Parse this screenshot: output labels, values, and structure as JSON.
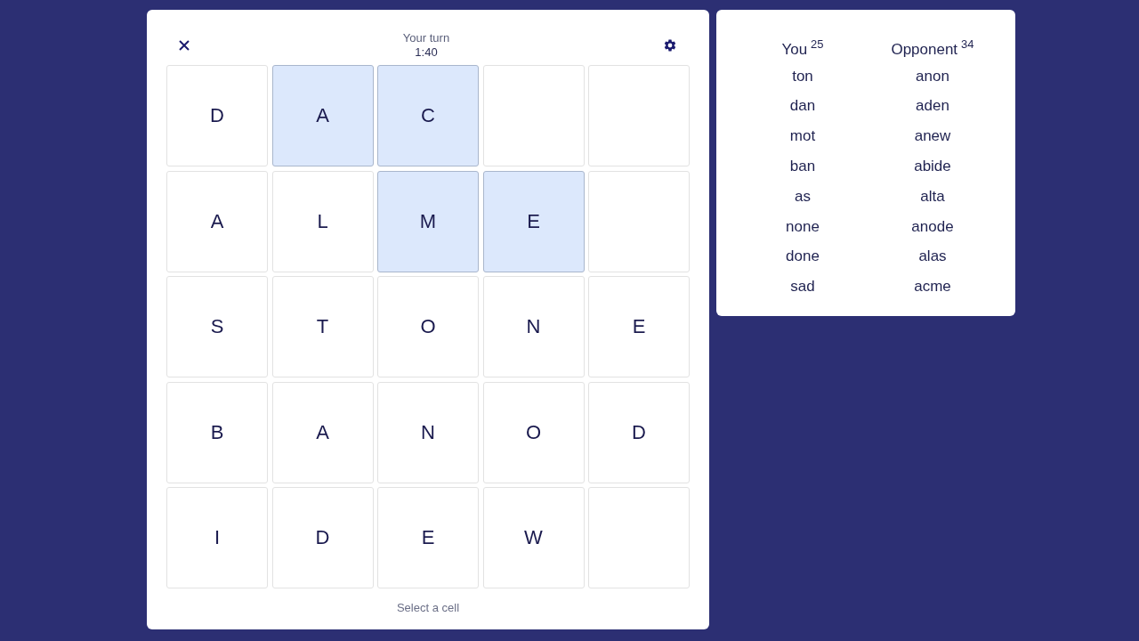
{
  "header": {
    "status": "Your turn",
    "timer": "1:40"
  },
  "board": [
    [
      {
        "letter": "D",
        "selected": false
      },
      {
        "letter": "A",
        "selected": true
      },
      {
        "letter": "C",
        "selected": true
      },
      {
        "selected": false
      },
      {
        "selected": false
      }
    ],
    [
      {
        "letter": "A",
        "selected": false
      },
      {
        "letter": "L",
        "selected": false
      },
      {
        "letter": "M",
        "selected": true
      },
      {
        "letter": "E",
        "selected": true
      },
      {
        "selected": false
      }
    ],
    [
      {
        "letter": "S",
        "selected": false
      },
      {
        "letter": "T",
        "selected": false
      },
      {
        "letter": "O",
        "selected": false
      },
      {
        "letter": "N",
        "selected": false
      },
      {
        "letter": "E",
        "selected": false
      }
    ],
    [
      {
        "letter": "B",
        "selected": false
      },
      {
        "letter": "A",
        "selected": false
      },
      {
        "letter": "N",
        "selected": false
      },
      {
        "letter": "O",
        "selected": false
      },
      {
        "letter": "D",
        "selected": false
      }
    ],
    [
      {
        "letter": "I",
        "selected": false
      },
      {
        "letter": "D",
        "selected": false
      },
      {
        "letter": "E",
        "selected": false
      },
      {
        "letter": "W",
        "selected": false
      },
      {
        "selected": false
      }
    ]
  ],
  "hint": "Select a cell",
  "players": [
    {
      "name": "You",
      "score": "25",
      "words": [
        "ton",
        "dan",
        "mot",
        "ban",
        "as",
        "none",
        "done",
        "sad"
      ]
    },
    {
      "name": "Opponent",
      "score": "34",
      "words": [
        "anon",
        "aden",
        "anew",
        "abide",
        "alta",
        "anode",
        "alas",
        "acme"
      ]
    }
  ]
}
